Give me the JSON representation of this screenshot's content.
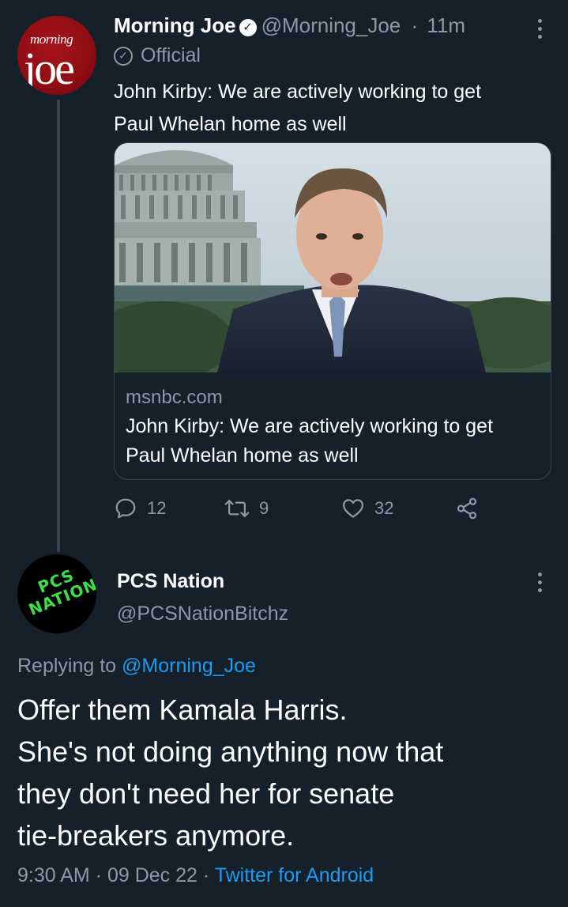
{
  "tweet1": {
    "avatar_text_small": "morning",
    "avatar_text_big": "joe",
    "name": "Morning Joe",
    "handle": "@Morning_Joe",
    "separator": "·",
    "time": "11m",
    "official_label": "Official",
    "text_line1": "John Kirby: We are actively working to get",
    "text_line2": "Paul Whelan home as well",
    "card": {
      "domain": "msnbc.com",
      "title_line1": "John Kirby: We are actively working to get",
      "title_line2": "Paul Whelan home as well"
    },
    "actions": {
      "reply_count": "12",
      "retweet_count": "9",
      "like_count": "32"
    }
  },
  "reply": {
    "avatar_text_line1": "PCS",
    "avatar_text_line2": "NATION",
    "name": "PCS Nation",
    "handle": "@PCSNationBitchz",
    "replying_prefix": "Replying to",
    "replying_mention": "@Morning_Joe",
    "text_line1": "Offer them Kamala Harris.",
    "text_line2": "She's not doing anything now that",
    "text_line3": "they don't need her for senate",
    "text_line4": "tie-breakers anymore.",
    "time": "9:30 AM",
    "date": "09 Dec 22",
    "separator": "·",
    "source": "Twitter for Android"
  },
  "colors": {
    "background": "#15202b",
    "text_primary": "#ffffff",
    "text_secondary": "#8b98a5",
    "link": "#1d9bf0",
    "border": "#38444d",
    "pcs_green": "#39e04a",
    "morning_joe_red": "#a8141b"
  },
  "icons": [
    "verified-icon",
    "official-badge-icon",
    "more-icon",
    "reply-icon",
    "retweet-icon",
    "like-icon",
    "share-icon"
  ]
}
